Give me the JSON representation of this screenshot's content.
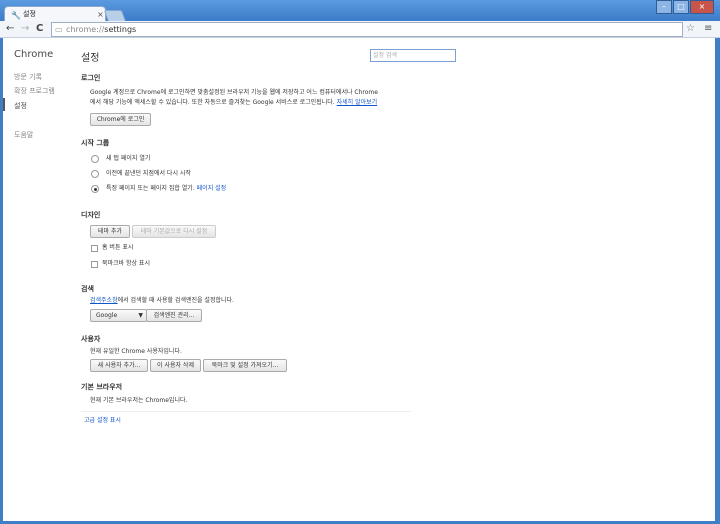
{
  "window": {
    "tab_title": "설정",
    "tab_icon": "wrench-icon",
    "tab_close": "×",
    "min": "–",
    "max": "□",
    "close": "×"
  },
  "toolbar": {
    "back": "←",
    "forward": "→",
    "reload": "C",
    "url_scheme": "chrome://",
    "url_path": "settings",
    "star": "☆",
    "menu": "≡"
  },
  "sidebar": {
    "title": "Chrome",
    "items": [
      {
        "label": "방문 기록"
      },
      {
        "label": "확장 프로그램"
      },
      {
        "label": "설정"
      },
      {
        "label": "도움말"
      }
    ]
  },
  "main": {
    "title": "설정",
    "search_placeholder": "설정 검색",
    "login": {
      "heading": "로그인",
      "desc_line1": "Google 계정으로 Chrome에 로그인하면 맞춤설정된 브라우저 기능을 웹에 저장하고 어느 컴퓨터에서나 Chrome",
      "desc_line2": "에서 해당 기능에 액세스할 수 있습니다. 또한 자동으로 즐겨찾는 Google 서비스로 로그인됩니다.",
      "learn_more": "자세히 알아보기",
      "button": "Chrome에 로그인"
    },
    "startup": {
      "heading": "시작 그룹",
      "options": [
        {
          "label": "새 탭 페이지 열기",
          "selected": false
        },
        {
          "label": "이전에 끝낸던 지점에서 다시 시작",
          "selected": false
        },
        {
          "label": "특정 페이지 또는 페이지 집합 열기.",
          "selected": true
        }
      ],
      "set_pages": "페이지 설정"
    },
    "appearance": {
      "heading": "디자인",
      "get_themes": "테마 추가",
      "reset_theme": "테마 기본값으로 다시 설정",
      "show_home": "홈 버튼 표시",
      "show_bookmarks": "북마크바 항상 표시"
    },
    "search": {
      "heading": "검색",
      "omnibox_link": "검색주소창",
      "desc": "에서 검색할 때 사용할 검색엔진을 설정합니다.",
      "engine": "Google",
      "manage": "검색엔진 관리..."
    },
    "users": {
      "heading": "사용자",
      "desc": "현재 유일한 Chrome 사용자입니다.",
      "add": "새 사용자 추가...",
      "delete": "이 사용자 삭제",
      "import": "북마크 및 설정 가져오기..."
    },
    "default_browser": {
      "heading": "기본 브라우저",
      "desc": "현재 기본 브라우저는 Chrome입니다."
    },
    "advanced": "고급 설정 표시"
  }
}
